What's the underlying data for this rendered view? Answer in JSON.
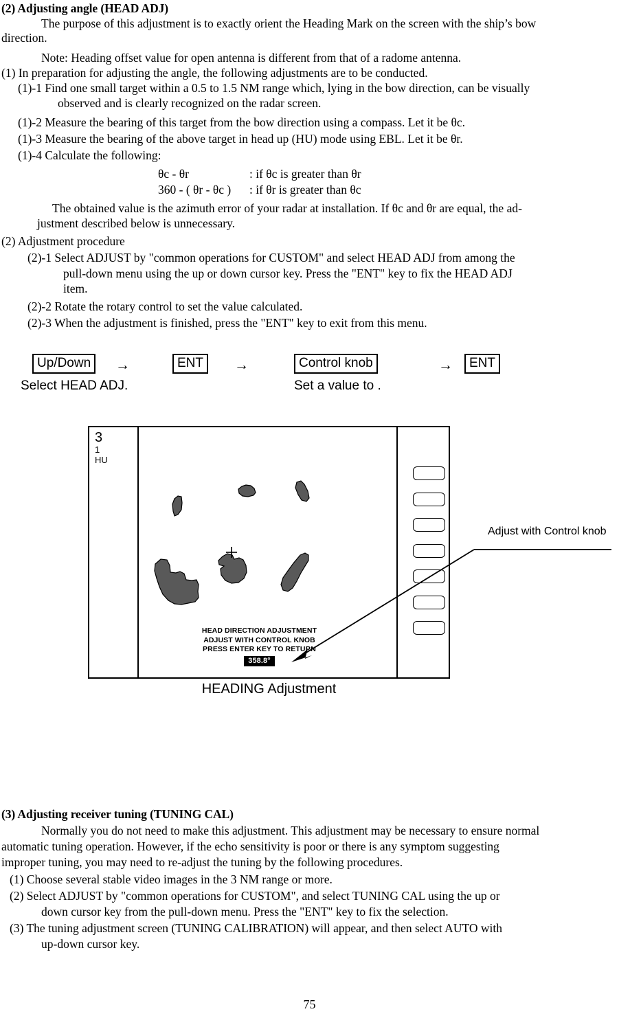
{
  "document": {
    "page_number": "75"
  },
  "section2": {
    "heading": "(2) Adjusting angle (HEAD ADJ)",
    "intro_line1": "The purpose of this adjustment is to exactly orient the Heading Mark on the screen with the ship’s bow",
    "intro_line2": "direction.",
    "note": "Note: Heading offset value for open antenna is different from that of a radome antenna.",
    "item1": "(1)  In preparation for adjusting the angle, the following adjustments are to be conducted.",
    "item1_1_line1": "(1)-1  Find one small target within a 0.5 to 1.5 NM range which, lying in the bow direction, can be visually",
    "item1_1_line2": "observed and is clearly recognized on the radar screen.",
    "item1_2": "(1)-2  Measure the bearing of this target from the bow direction using a compass. Let it be θc.",
    "item1_3": "(1)-3  Measure the bearing of the above target in head up (HU) mode using EBL. Let it be θr.",
    "item1_4": "(1)-4  Calculate the following:",
    "formula1_left": "θc - θr",
    "formula1_right": ":  if θc is greater than θr",
    "formula2_left": "360 - ( θr - θc )",
    "formula2_right": ":  if θr is greater than θc",
    "result_line1": "The obtained value is the azimuth error of your radar at installation. If θc and θr are equal, the ad-",
    "result_line2": "justment described below is unnecessary.",
    "item2": "(2) Adjustment procedure",
    "item2_1_line1": "(2)-1  Select ADJUST by \"common operations for CUSTOM\" and select HEAD ADJ from among the",
    "item2_1_line2": "pull-down menu using the up or down cursor key.  Press the \"ENT\" key to fix the HEAD ADJ",
    "item2_1_line3": "item.",
    "item2_2": "(2)-2  Rotate the rotary control to set the value calculated.",
    "item2_3": "(2)-3  When the adjustment is finished, press the \"ENT\" key to exit from this menu."
  },
  "flow": {
    "step1_box": "Up/Down",
    "arrow1": "→",
    "step2_box": "ENT",
    "arrow2": "→",
    "step3_box": "Control knob",
    "arrow3": "→",
    "step4_box": "ENT",
    "caption1": "Select HEAD ADJ.",
    "caption2": "Set a value to ."
  },
  "radar": {
    "range_label": "3",
    "range_unit_label": "1",
    "mode_label": "HU",
    "osd_line1": "HEAD DIRECTION ADJUSTMENT",
    "osd_line2": "ADJUST WITH CONTROL KNOB",
    "osd_line3": "PRESS ENTER KEY TO RETURN",
    "heading_value": "358.8°",
    "softkey_count": 7,
    "echo_color": "#595959",
    "caption": "HEADING Adjustment",
    "callout": "Adjust with Control knob",
    "echoes": [
      "M 150 86 L 156 84 L 163 85 L 168 89 L 170 95 L 167 99 L 159 101 L 151 100 L 146 96 L 145 90 Z",
      "M 52 104 L 57 100 L 62 101 L 63 110 L 62 120 L 57 127 L 52 129 L 50 122 L 49 112 Z",
      "M 230 80 L 236 78 L 241 83 L 246 93 L 248 103 L 244 108 L 237 106 L 232 98 L 228 88 Z",
      "M 24 199 L 32 192 L 41 193 L 45 201 L 46 211 L 54 212 L 60 210 L 66 213 L 69 222 L 77 223 L 84 222 L 87 229 L 86 239 L 87 248 L 82 254 L 72 256 L 62 258 L 52 257 L 43 252 L 35 243 L 30 232 L 26 220 L 23 209 Z",
      "M 122 188 L 129 184 L 136 186 L 139 192 L 146 190 L 152 193 L 156 201 L 157 211 L 153 220 L 145 226 L 135 227 L 126 223 L 120 215 L 119 206 L 124 202 L 117 200 L 116 194 Z",
      "M 235 186 L 242 183 L 247 186 L 247 194 L 242 202 L 236 212 L 230 224 L 224 234 L 217 239 L 210 237 L 207 229 L 210 219 L 217 209 L 225 198 Z"
    ]
  }
}
